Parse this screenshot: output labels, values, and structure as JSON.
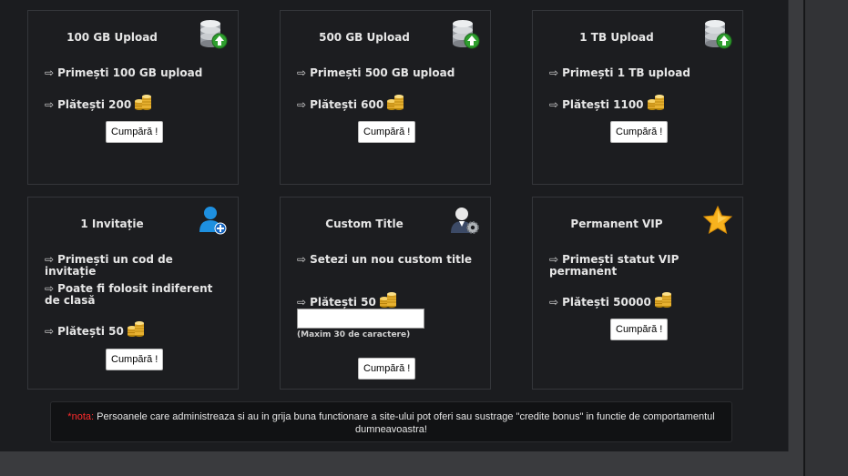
{
  "arrow": "⇨",
  "boxes": [
    {
      "title": "100 GB Upload",
      "icon": "database-upload-icon",
      "lines": [
        "Primești 100 GB upload",
        "Plătești 200"
      ],
      "button": "Cumpără !"
    },
    {
      "title": "500 GB Upload",
      "icon": "database-upload-icon",
      "lines": [
        "Primești 500 GB upload",
        "Plătești 600"
      ],
      "button": "Cumpără !"
    },
    {
      "title": "1 TB Upload",
      "icon": "database-upload-icon",
      "lines": [
        "Primești 1 TB upload",
        "Plătești 1100"
      ],
      "button": "Cumpără !"
    },
    {
      "title": "1 Invitație",
      "icon": "add-user-icon",
      "lines": [
        "Primești un cod de invitație",
        "Poate fi folosit indiferent de clasă",
        "Plătești 50"
      ],
      "button": "Cumpără !"
    },
    {
      "title": "Custom Title",
      "icon": "user-settings-icon",
      "lines": [
        "Setezi un nou custom title",
        "Plătești 50"
      ],
      "input_value": "",
      "input_hint": "(Maxim 30 de caractere)",
      "button": "Cumpără !"
    },
    {
      "title": "Permanent VIP",
      "icon": "star-icon",
      "lines": [
        "Primești statut VIP permanent",
        "Plătești 50000"
      ],
      "button": "Cumpără !"
    }
  ],
  "note": {
    "label": "*nota:",
    "text": "Persoanele care administreaza si au in grija buna functionare a site-ului pot oferi sau sustrage \"credite bonus\" in functie de comportamentul dumneavoastra!"
  },
  "colors": {
    "panel_bg": "#1b1c1f",
    "box_border": "#34363a",
    "text": "#e6e6e6",
    "note_label": "#ff2b2b",
    "gold": "#d4a017"
  }
}
